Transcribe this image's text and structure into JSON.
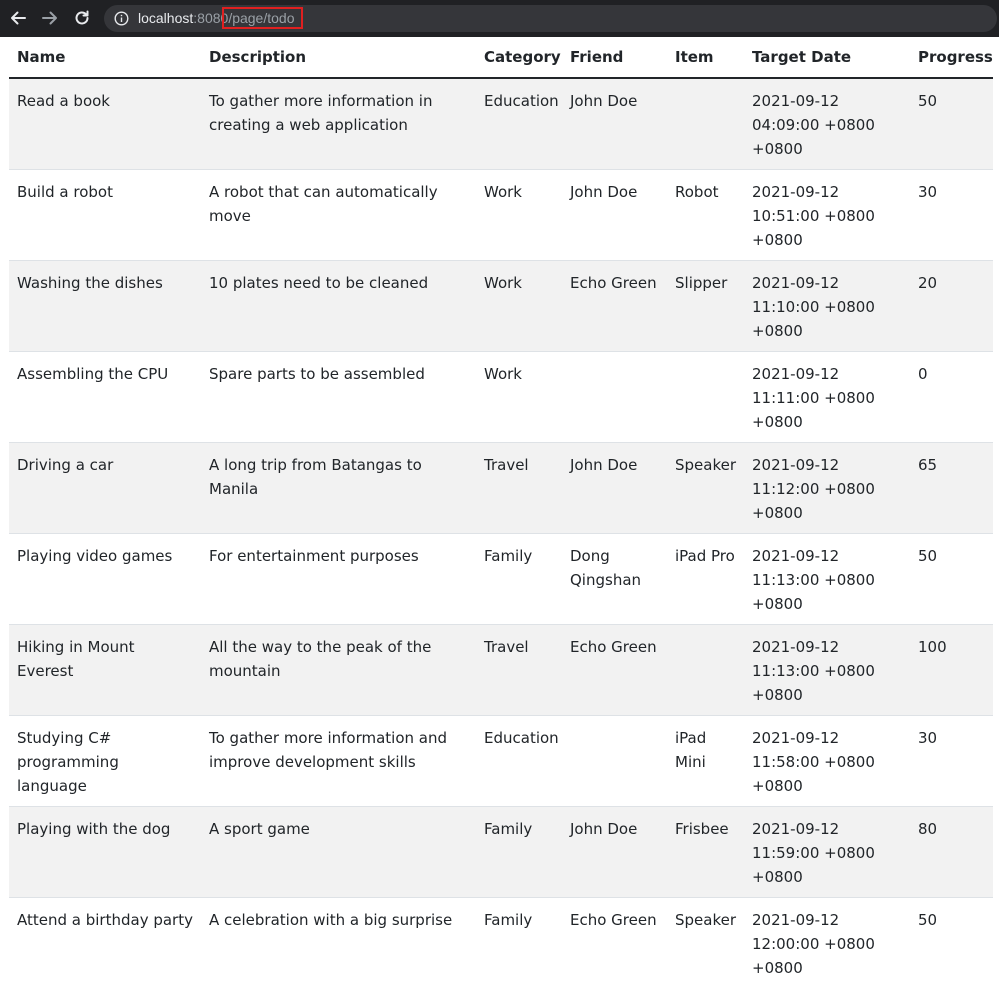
{
  "browser": {
    "url_host": "localhost",
    "url_port": ":8080",
    "url_path": "/page/todo"
  },
  "table": {
    "headers": {
      "name": "Name",
      "description": "Description",
      "category": "Category",
      "friend": "Friend",
      "item": "Item",
      "target_date": "Target Date",
      "progress": "Progress"
    },
    "rows": [
      {
        "name": "Read a book",
        "description": "To gather more information in creating a web application",
        "category": "Education",
        "friend": "John Doe",
        "item": "",
        "target_date": "2021-09-12 04:09:00 +0800 +0800",
        "progress": "50"
      },
      {
        "name": "Build a robot",
        "description": "A robot that can automatically move",
        "category": "Work",
        "friend": "John Doe",
        "item": "Robot",
        "target_date": "2021-09-12 10:51:00 +0800 +0800",
        "progress": "30"
      },
      {
        "name": "Washing the dishes",
        "description": "10 plates need to be cleaned",
        "category": "Work",
        "friend": "Echo Green",
        "item": "Slipper",
        "target_date": "2021-09-12 11:10:00 +0800 +0800",
        "progress": "20"
      },
      {
        "name": "Assembling the CPU",
        "description": "Spare parts to be assembled",
        "category": "Work",
        "friend": "",
        "item": "",
        "target_date": "2021-09-12 11:11:00 +0800 +0800",
        "progress": "0"
      },
      {
        "name": "Driving a car",
        "description": "A long trip from Batangas to Manila",
        "category": "Travel",
        "friend": "John Doe",
        "item": "Speaker",
        "target_date": "2021-09-12 11:12:00 +0800 +0800",
        "progress": "65"
      },
      {
        "name": "Playing video games",
        "description": "For entertainment purposes",
        "category": "Family",
        "friend": "Dong Qingshan",
        "item": "iPad Pro",
        "target_date": "2021-09-12 11:13:00 +0800 +0800",
        "progress": "50"
      },
      {
        "name": "Hiking in Mount Everest",
        "description": "All the way to the peak of the mountain",
        "category": "Travel",
        "friend": "Echo Green",
        "item": "",
        "target_date": "2021-09-12 11:13:00 +0800 +0800",
        "progress": "100"
      },
      {
        "name": "Studying C# programming language",
        "description": "To gather more information and improve development skills",
        "category": "Education",
        "friend": "",
        "item": "iPad Mini",
        "target_date": "2021-09-12 11:58:00 +0800 +0800",
        "progress": "30"
      },
      {
        "name": "Playing with the dog",
        "description": "A sport game",
        "category": "Family",
        "friend": "John Doe",
        "item": "Frisbee",
        "target_date": "2021-09-12 11:59:00 +0800 +0800",
        "progress": "80"
      },
      {
        "name": "Attend a birthday party",
        "description": "A celebration with a big surprise",
        "category": "Family",
        "friend": "Echo Green",
        "item": "Speaker",
        "target_date": "2021-09-12 12:00:00 +0800 +0800",
        "progress": "50"
      }
    ]
  }
}
